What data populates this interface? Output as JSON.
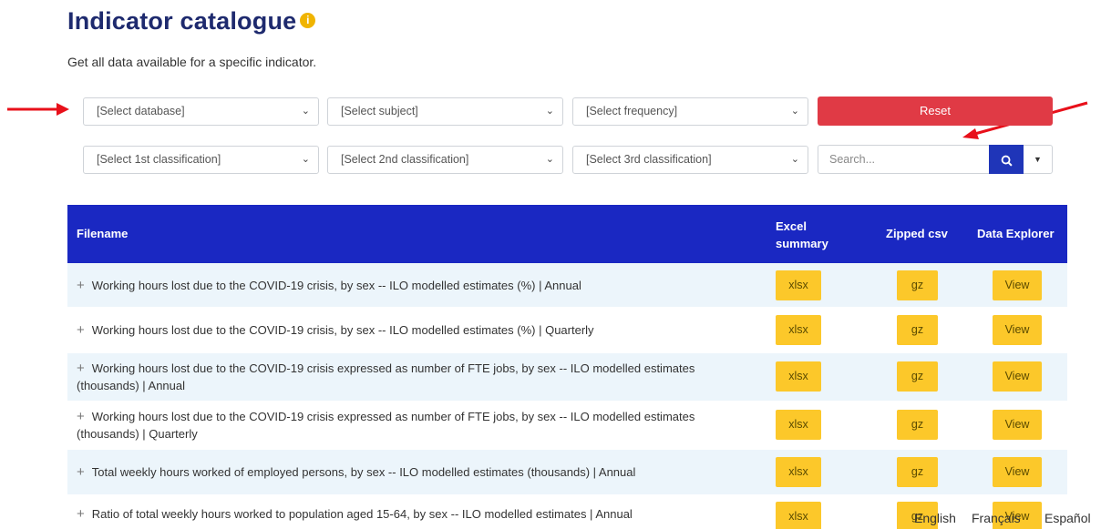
{
  "header": {
    "title": "Indicator catalogue",
    "info_glyph": "i",
    "subtitle": "Get all data available for a specific indicator."
  },
  "filters": {
    "row1": [
      "[Select database]",
      "[Select subject]",
      "[Select frequency]"
    ],
    "row2": [
      "[Select 1st classification]",
      "[Select 2nd classification]",
      "[Select 3rd classification]"
    ],
    "reset_label": "Reset",
    "search_placeholder": "Search..."
  },
  "table": {
    "headers": {
      "filename": "Filename",
      "excel_line1": "Excel",
      "excel_line2": "summary",
      "zipped": "Zipped csv",
      "explorer": "Data Explorer"
    },
    "rows": [
      {
        "label": "Working hours lost due to the COVID-19 crisis, by sex -- ILO modelled estimates (%) | Annual",
        "xlsx": "xlsx",
        "gz": "gz",
        "view": "View"
      },
      {
        "label": "Working hours lost due to the COVID-19 crisis, by sex -- ILO modelled estimates (%) | Quarterly",
        "xlsx": "xlsx",
        "gz": "gz",
        "view": "View"
      },
      {
        "label": "Working hours lost due to the COVID-19 crisis expressed as number of FTE jobs, by sex -- ILO modelled estimates (thousands) | Annual",
        "xlsx": "xlsx",
        "gz": "gz",
        "view": "View"
      },
      {
        "label": "Working hours lost due to the COVID-19 crisis expressed as number of FTE jobs, by sex -- ILO modelled estimates (thousands) | Quarterly",
        "xlsx": "xlsx",
        "gz": "gz",
        "view": "View"
      },
      {
        "label": "Total weekly hours worked of employed persons, by sex -- ILO modelled estimates (thousands) | Annual",
        "xlsx": "xlsx",
        "gz": "gz",
        "view": "View"
      },
      {
        "label": "Ratio of total weekly hours worked to population aged 15-64, by sex -- ILO modelled estimates | Annual",
        "xlsx": "xlsx",
        "gz": "gz",
        "view": "View"
      }
    ]
  },
  "languages": [
    "English",
    "Français",
    "Español"
  ],
  "colors": {
    "header_blue": "#1a28c2",
    "reset_red": "#e03a45",
    "button_yellow": "#fcc82a",
    "annotation_red": "#e8101a",
    "title_navy": "#1e2a6e"
  },
  "icons": {
    "search": "search-icon",
    "chevron": "chevron-down-icon",
    "expand": "plus-icon",
    "info": "info-icon"
  }
}
